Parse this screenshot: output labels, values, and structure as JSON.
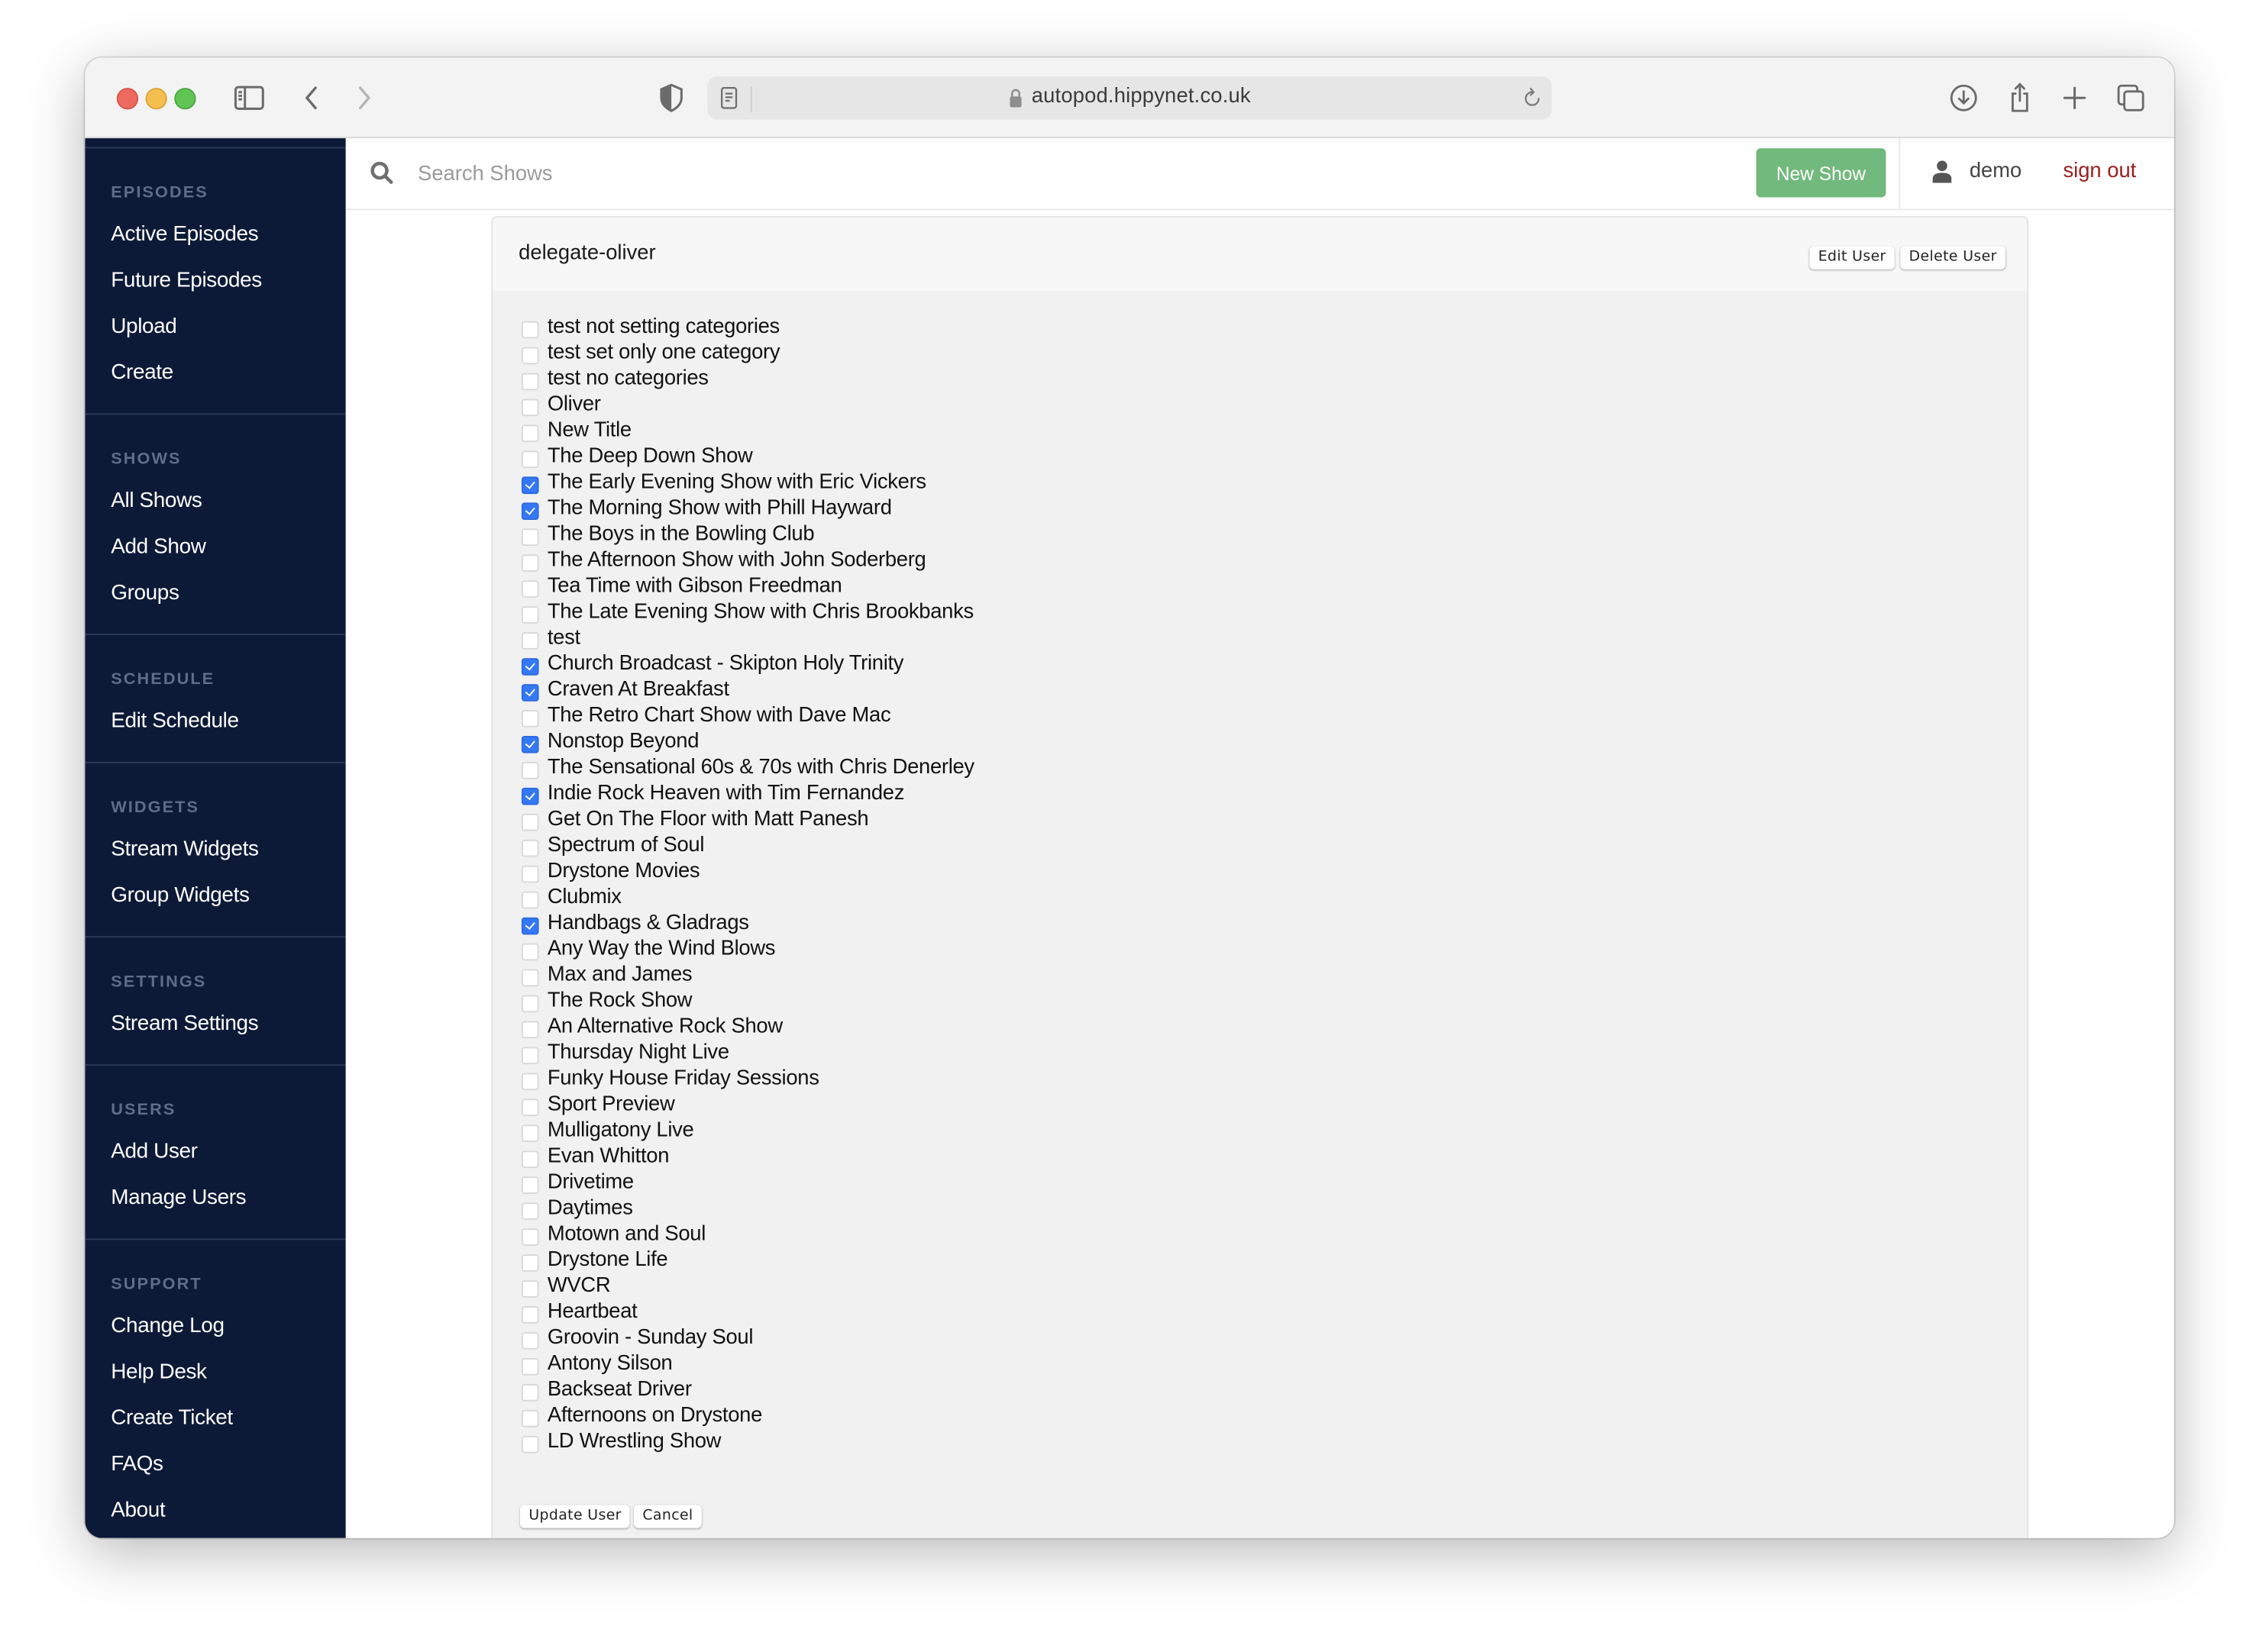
{
  "browser": {
    "url": "autopod.hippynet.co.uk"
  },
  "sidebar": {
    "sections": [
      {
        "heading": "EPISODES",
        "items": [
          "Active Episodes",
          "Future Episodes",
          "Upload",
          "Create"
        ]
      },
      {
        "heading": "SHOWS",
        "items": [
          "All Shows",
          "Add Show",
          "Groups"
        ]
      },
      {
        "heading": "SCHEDULE",
        "items": [
          "Edit Schedule"
        ]
      },
      {
        "heading": "WIDGETS",
        "items": [
          "Stream Widgets",
          "Group Widgets"
        ]
      },
      {
        "heading": "SETTINGS",
        "items": [
          "Stream Settings"
        ]
      },
      {
        "heading": "USERS",
        "items": [
          "Add User",
          "Manage Users"
        ]
      },
      {
        "heading": "SUPPORT",
        "items": [
          "Change Log",
          "Help Desk",
          "Create Ticket",
          "FAQs",
          "About"
        ]
      }
    ]
  },
  "appbar": {
    "search_placeholder": "Search Shows",
    "search_value": "",
    "new_show_label": "New Show",
    "username": "demo",
    "signout_label": "sign out",
    "new_show_color": "#71b97c",
    "signout_color": "#9a1c1c"
  },
  "card": {
    "title": "delegate-oliver",
    "edit_user_label": "Edit User",
    "delete_user_label": "Delete User",
    "update_user_label": "Update User",
    "cancel_label": "Cancel",
    "shows": [
      {
        "name": "test not setting categories",
        "checked": false
      },
      {
        "name": "test set only one category",
        "checked": false
      },
      {
        "name": "test no categories",
        "checked": false
      },
      {
        "name": "Oliver",
        "checked": false
      },
      {
        "name": "New Title",
        "checked": false
      },
      {
        "name": "The Deep Down Show",
        "checked": false
      },
      {
        "name": "The Early Evening Show with Eric Vickers",
        "checked": true
      },
      {
        "name": "The Morning Show with Phill Hayward",
        "checked": true
      },
      {
        "name": "The Boys in the Bowling Club",
        "checked": false
      },
      {
        "name": "The Afternoon Show with John Soderberg",
        "checked": false
      },
      {
        "name": "Tea Time with Gibson Freedman",
        "checked": false
      },
      {
        "name": "The Late Evening Show with Chris Brookbanks",
        "checked": false
      },
      {
        "name": "test",
        "checked": false
      },
      {
        "name": "Church Broadcast - Skipton Holy Trinity",
        "checked": true
      },
      {
        "name": "Craven At Breakfast",
        "checked": true
      },
      {
        "name": "The Retro Chart Show with Dave Mac",
        "checked": false
      },
      {
        "name": "Nonstop Beyond",
        "checked": true
      },
      {
        "name": "The Sensational 60s & 70s with Chris Denerley",
        "checked": false
      },
      {
        "name": "Indie Rock Heaven with Tim Fernandez",
        "checked": true
      },
      {
        "name": "Get On The Floor with Matt Panesh",
        "checked": false
      },
      {
        "name": "Spectrum of Soul",
        "checked": false
      },
      {
        "name": "Drystone Movies",
        "checked": false
      },
      {
        "name": "Clubmix",
        "checked": false
      },
      {
        "name": "Handbags & Gladrags",
        "checked": true
      },
      {
        "name": "Any Way the Wind Blows",
        "checked": false
      },
      {
        "name": "Max and James",
        "checked": false
      },
      {
        "name": "The Rock Show",
        "checked": false
      },
      {
        "name": "An Alternative Rock Show",
        "checked": false
      },
      {
        "name": "Thursday Night Live",
        "checked": false
      },
      {
        "name": "Funky House Friday Sessions",
        "checked": false
      },
      {
        "name": "Sport Preview",
        "checked": false
      },
      {
        "name": "Mulligatony Live",
        "checked": false
      },
      {
        "name": "Evan Whitton",
        "checked": false
      },
      {
        "name": "Drivetime",
        "checked": false
      },
      {
        "name": "Daytimes",
        "checked": false
      },
      {
        "name": "Motown and Soul",
        "checked": false
      },
      {
        "name": "Drystone Life",
        "checked": false
      },
      {
        "name": "WVCR",
        "checked": false
      },
      {
        "name": "Heartbeat",
        "checked": false
      },
      {
        "name": "Groovin - Sunday Soul",
        "checked": false
      },
      {
        "name": "Antony Silson",
        "checked": false
      },
      {
        "name": "Backseat Driver",
        "checked": false
      },
      {
        "name": "Afternoons on Drystone",
        "checked": false
      },
      {
        "name": "LD Wrestling Show",
        "checked": false
      }
    ]
  }
}
